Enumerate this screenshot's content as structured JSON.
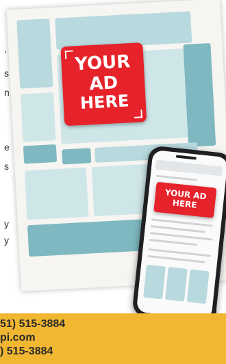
{
  "ad_placeholder": {
    "line1": "YOUR",
    "line2": "AD",
    "line3": "HERE"
  },
  "phone_ad": {
    "line1": "YOUR AD",
    "line2": "HERE"
  },
  "text_fragments": [
    ",",
    "s",
    "n",
    "e",
    "s",
    "y",
    "y"
  ],
  "contact": {
    "line1": "51) 515-3884",
    "line2": "pi.com",
    "line3": ") 515-3884"
  },
  "colors": {
    "ad_red": "#e6222a",
    "block_teal": "#b8d9de",
    "footer_yellow": "#f2b731"
  }
}
